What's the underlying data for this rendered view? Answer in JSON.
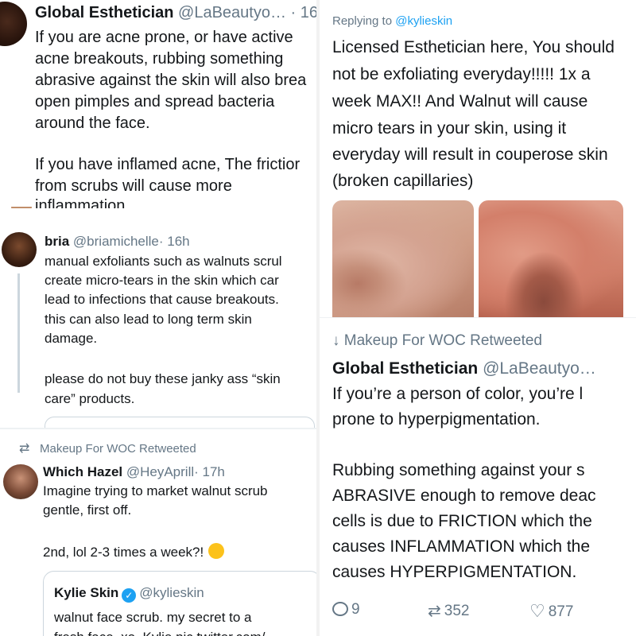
{
  "panel1": {
    "author": {
      "name": "Global Esthetician",
      "handle": "@LaBeautyo…",
      "time": "· 16"
    },
    "lines": [
      "If you are acne prone, or have active",
      "acne breakouts, rubbing something",
      "abrasive against the skin will also brea",
      "open pimples and spread bacteria",
      "around the face.",
      "If you have inflamed acne, The frictior",
      "from scrubs will cause more",
      "inflammation."
    ]
  },
  "panel2": {
    "author": {
      "name": "bria",
      "handle": "@briamichelle",
      "time": "· 16h"
    },
    "lines": [
      "manual exfoliants such as walnuts scrul",
      "create micro-tears in the skin which car",
      "lead to infections that cause breakouts.",
      "this can also lead to long term skin",
      "damage.",
      "please do not buy these janky ass “skin",
      "care” products."
    ]
  },
  "panel3": {
    "retweet_icon": "⇄",
    "retweeted_by": "Makeup For WOC Retweeted",
    "author": {
      "name": "Which Hazel",
      "handle": "@HeyAprill",
      "time": "· 17h"
    },
    "lines": [
      "Imagine trying to market walnut scrub",
      "gentle, first off.",
      "2nd, lol 2-3 times a week?!"
    ],
    "quote": {
      "name": "Kylie Skin",
      "verified_icon": "✓",
      "handle": "@kylieskin",
      "lines": [
        "walnut face scrub. my secret to a",
        "fresh face. xo. Kylie pic.twitter.com/"
      ]
    }
  },
  "panel4": {
    "replying_prefix": "Replying to",
    "replying_handle": "@kylieskin",
    "lines": [
      "Licensed Esthetician here, You should",
      "not be exfoliating everyday!!!!! 1x a",
      "week MAX!! And Walnut will cause",
      "micro tears in your skin, using it",
      "everyday will result in couperose skin",
      "(broken capillaries)"
    ]
  },
  "panel5": {
    "retweeted_by": "Makeup For WOC Retweeted",
    "retweet_marker": "↓",
    "author": {
      "name": "Global Esthetician",
      "handle": "@LaBeautyo…"
    },
    "lines": [
      "If you’re a person of color, you’re l",
      "prone to hyperpigmentation.",
      "Rubbing something against your s",
      "ABRASIVE enough to remove deac",
      "cells is due to FRICTION which the",
      "causes INFLAMMATION which the",
      "causes HYPERPIGMENTATION."
    ],
    "actions": {
      "replies": "9",
      "retweets": "352",
      "likes": "877",
      "retweet_icon": "⇄",
      "heart_icon": "♡"
    }
  },
  "colors": {
    "text": "#14171a",
    "muted": "#657786",
    "link": "#1da1f2",
    "border": "#ccd6dd"
  }
}
